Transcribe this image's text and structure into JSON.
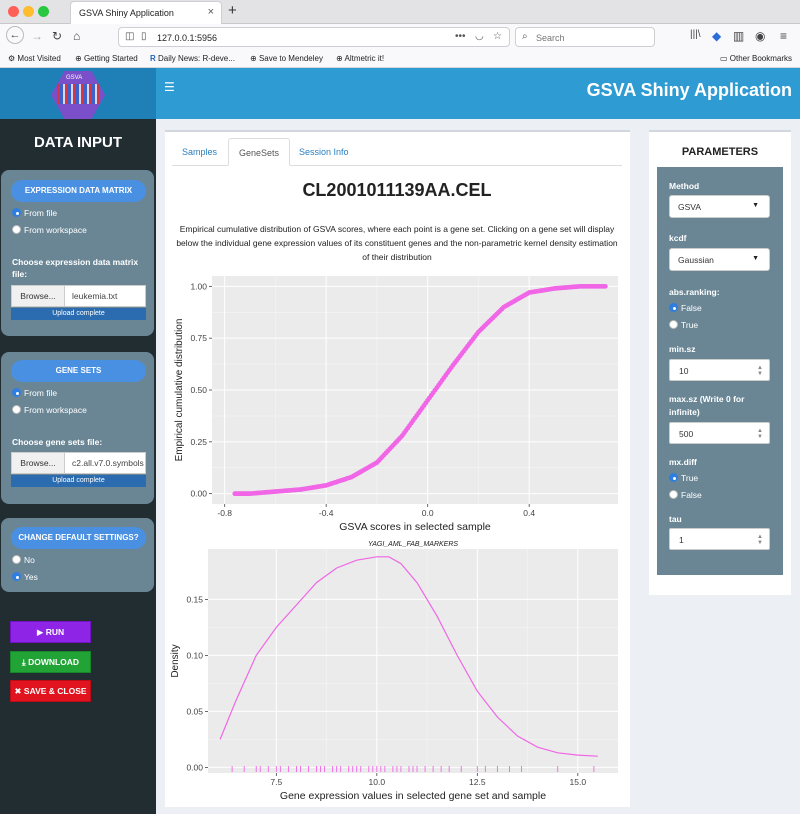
{
  "browser": {
    "tab_title": "GSVA Shiny Application",
    "url": "127.0.0.1:5956",
    "search_placeholder": "Search",
    "bookmarks": [
      "Most Visited",
      "Getting Started",
      "Daily News: R-deve...",
      "Save to Mendeley",
      "Altmetric it!",
      "Other Bookmarks"
    ]
  },
  "app": {
    "logo_text": "GSVA",
    "title": "GSVA Shiny Application"
  },
  "sidebar": {
    "title": "DATA INPUT",
    "expression": {
      "header": "EXPRESSION DATA MATRIX",
      "opt_file": "From file",
      "opt_workspace": "From workspace",
      "choose_label": "Choose expression data matrix file:",
      "browse": "Browse...",
      "file_name": "leukemia.txt",
      "upload_status": "Upload complete"
    },
    "genesets": {
      "header": "GENE SETS",
      "opt_file": "From file",
      "opt_workspace": "From workspace",
      "choose_label": "Choose gene sets file:",
      "browse": "Browse...",
      "file_name": "c2.all.v7.0.symbols.gmt",
      "upload_status": "Upload complete"
    },
    "defaults": {
      "header": "CHANGE DEFAULT SETTINGS?",
      "opt_no": "No",
      "opt_yes": "Yes"
    },
    "run": "RUN",
    "download": "DOWNLOAD",
    "save_close": "SAVE & CLOSE"
  },
  "main": {
    "tabs": [
      "Samples",
      "GeneSets",
      "Session Info"
    ],
    "active_tab": "GeneSets",
    "sample_title": "CL2001011139AA.CEL",
    "description": "Empirical cumulative distribution of GSVA scores, where each point is a gene set. Clicking on a gene set will display below the individual gene expression values of its constituent genes and the non-parametric kernel density estimation of their distribution"
  },
  "parameters": {
    "title": "PARAMETERS",
    "method_label": "Method",
    "method_value": "GSVA",
    "kcdf_label": "kcdf",
    "kcdf_value": "Gaussian",
    "abs_ranking_label": "abs.ranking:",
    "abs_false": "False",
    "abs_true": "True",
    "min_sz_label": "min.sz",
    "min_sz_value": "10",
    "max_sz_label": "max.sz (Write 0 for infinite)",
    "max_sz_value": "500",
    "mx_diff_label": "mx.diff",
    "mx_true": "True",
    "mx_false": "False",
    "tau_label": "tau",
    "tau_value": "1"
  },
  "chart_data": [
    {
      "type": "scatter",
      "title": "",
      "xlabel": "GSVA scores in selected sample",
      "ylabel": "Empirical cumulative distribution",
      "xlim": [
        -0.85,
        0.75
      ],
      "ylim": [
        -0.05,
        1.05
      ],
      "xticks": [
        -0.8,
        -0.4,
        0.0,
        0.4
      ],
      "yticks": [
        0.0,
        0.25,
        0.5,
        0.75,
        1.0
      ],
      "xtick_labels": [
        "-0.8",
        "-0.4",
        "0.0",
        "0.4"
      ],
      "ytick_labels": [
        "0.00",
        "0.25",
        "0.50",
        "0.75",
        "1.00"
      ],
      "series": [
        {
          "color": "#f066e6",
          "x": [
            -0.76,
            -0.7,
            -0.6,
            -0.5,
            -0.4,
            -0.3,
            -0.2,
            -0.1,
            0.0,
            0.1,
            0.2,
            0.3,
            0.4,
            0.5,
            0.6,
            0.7
          ],
          "y": [
            0.0,
            0.0,
            0.01,
            0.02,
            0.04,
            0.08,
            0.15,
            0.28,
            0.45,
            0.62,
            0.78,
            0.9,
            0.97,
            0.99,
            1.0,
            1.0
          ]
        }
      ],
      "grid": true
    },
    {
      "type": "line",
      "title": "YAGI_AML_FAB_MARKERS",
      "xlabel": "Gene expression values in selected gene set and sample",
      "ylabel": "Density",
      "xlim": [
        5.8,
        16.0
      ],
      "ylim": [
        -0.005,
        0.195
      ],
      "xticks": [
        7.5,
        10.0,
        12.5,
        15.0
      ],
      "yticks": [
        0.0,
        0.05,
        0.1,
        0.15
      ],
      "xtick_labels": [
        "7.5",
        "10.0",
        "12.5",
        "15.0"
      ],
      "ytick_labels": [
        "0.00",
        "0.05",
        "0.10",
        "0.15"
      ],
      "series": [
        {
          "color": "#f066e6",
          "x": [
            6.1,
            6.5,
            7.0,
            7.5,
            8.0,
            8.5,
            9.0,
            9.5,
            10.0,
            10.3,
            10.6,
            11.0,
            11.5,
            12.0,
            12.5,
            13.0,
            13.5,
            14.0,
            14.5,
            15.0,
            15.5
          ],
          "y": [
            0.025,
            0.06,
            0.1,
            0.125,
            0.145,
            0.165,
            0.178,
            0.185,
            0.188,
            0.188,
            0.182,
            0.165,
            0.135,
            0.1,
            0.068,
            0.045,
            0.028,
            0.018,
            0.013,
            0.011,
            0.01
          ]
        }
      ],
      "rug": [
        6.4,
        6.7,
        7.0,
        7.1,
        7.3,
        7.5,
        7.6,
        7.8,
        8.0,
        8.1,
        8.3,
        8.5,
        8.6,
        8.7,
        8.9,
        9.0,
        9.1,
        9.3,
        9.4,
        9.5,
        9.6,
        9.8,
        9.9,
        10.0,
        10.1,
        10.2,
        10.4,
        10.5,
        10.6,
        10.8,
        10.9,
        11.0,
        11.2,
        11.4,
        11.6,
        11.8,
        12.1,
        12.5,
        12.7,
        13.0,
        13.3,
        13.6,
        14.5,
        15.4
      ],
      "grid": true
    }
  ]
}
